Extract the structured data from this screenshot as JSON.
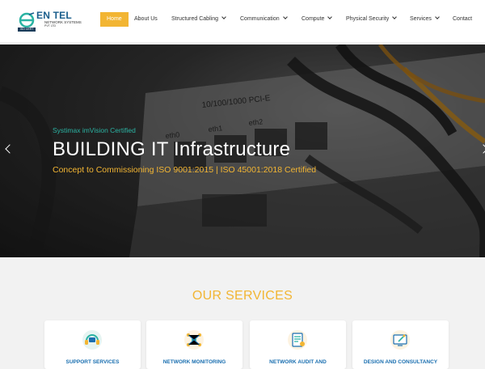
{
  "brand": {
    "name": "EN TEL",
    "subtitle": "NETWORK SYSTEMS",
    "subtitle2": "PVT LTD",
    "tag": "ISO CERT"
  },
  "nav": {
    "items": [
      {
        "label": "Home",
        "active": true
      },
      {
        "label": "About Us"
      },
      {
        "label": "Structured Cabling",
        "dropdown": true
      },
      {
        "label": "Communication",
        "dropdown": true
      },
      {
        "label": "Compute",
        "dropdown": true
      },
      {
        "label": "Physical Security",
        "dropdown": true
      },
      {
        "label": "Services",
        "dropdown": true
      },
      {
        "label": "Contact"
      }
    ]
  },
  "hero": {
    "kicker": "Systimax imVision Certified",
    "title": "BUILDING IT Infrastructure",
    "subtitle": "Concept to Commissioning ISO 9001:2015 | ISO 45001:2018 Certified",
    "port_label": "10/100/1000 PCI-E",
    "eth1": "eth1",
    "eth2": "eth2",
    "eth0": "eth0"
  },
  "services": {
    "title": "OUR SERVICES",
    "cards": [
      {
        "label": "SUPPORT SERVICES",
        "icon": "headset-support-icon"
      },
      {
        "label": "NETWORK MONITORING",
        "icon": "network-monitoring-icon"
      },
      {
        "label": "NETWORK AUDIT AND",
        "icon": "network-audit-icon"
      },
      {
        "label": "DESIGN AND CONSULTANCY",
        "icon": "design-consultancy-icon"
      }
    ]
  },
  "colors": {
    "accent": "#f2b533",
    "teal": "#2bb3a3",
    "link_blue": "#1a6fb0"
  }
}
